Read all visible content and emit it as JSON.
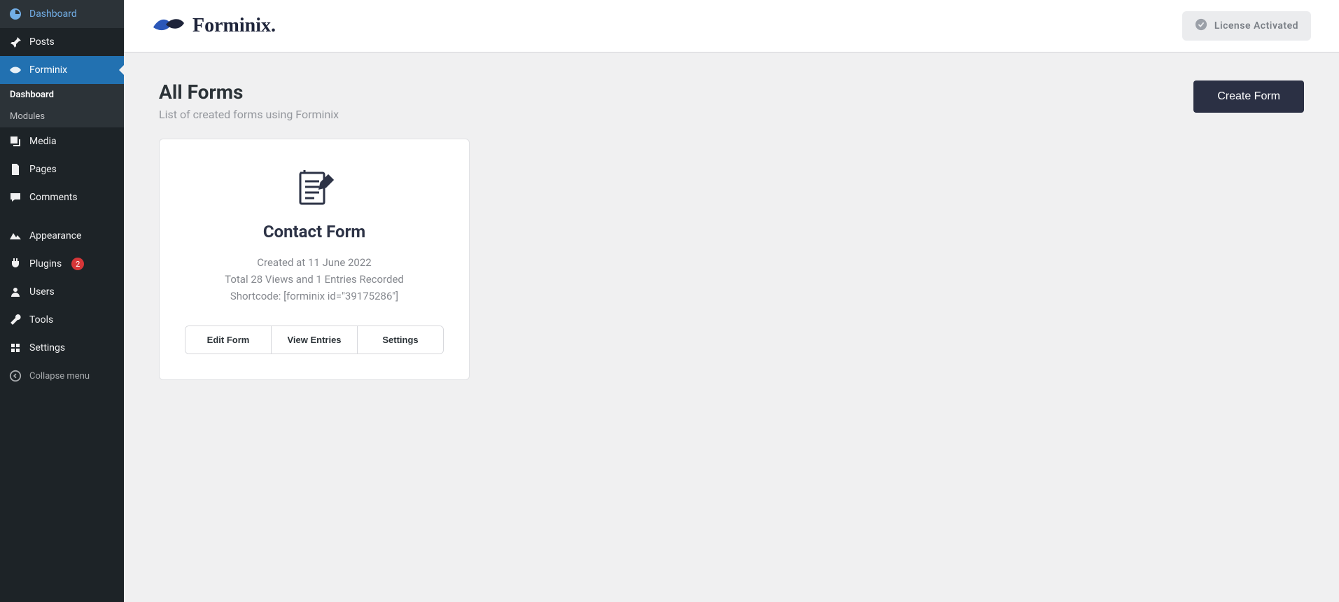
{
  "sidebar": {
    "items": [
      {
        "label": "Dashboard",
        "icon": "dashboard"
      },
      {
        "label": "Posts",
        "icon": "pin"
      },
      {
        "label": "Forminix",
        "icon": "forminix",
        "active": true
      },
      {
        "label": "Media",
        "icon": "media"
      },
      {
        "label": "Pages",
        "icon": "pages"
      },
      {
        "label": "Comments",
        "icon": "comments"
      },
      {
        "label": "Appearance",
        "icon": "appearance"
      },
      {
        "label": "Plugins",
        "icon": "plugins",
        "badge": "2"
      },
      {
        "label": "Users",
        "icon": "users"
      },
      {
        "label": "Tools",
        "icon": "tools"
      },
      {
        "label": "Settings",
        "icon": "settings"
      }
    ],
    "sub": [
      {
        "label": "Dashboard",
        "current": true
      },
      {
        "label": "Modules"
      }
    ],
    "collapse_label": "Collapse menu"
  },
  "topbar": {
    "brand": "Forminix.",
    "license_label": "License Activated"
  },
  "page": {
    "title": "All Forms",
    "subtitle": "List of created forms using Forminix",
    "create_button": "Create Form"
  },
  "forms": [
    {
      "title": "Contact Form",
      "created_line": "Created at 11 June 2022",
      "stats_line": "Total 28 Views and 1 Entries Recorded",
      "shortcode_line": "Shortcode: [forminix id=\"39175286\"]",
      "actions": {
        "edit": "Edit Form",
        "view": "View Entries",
        "settings": "Settings"
      }
    }
  ]
}
